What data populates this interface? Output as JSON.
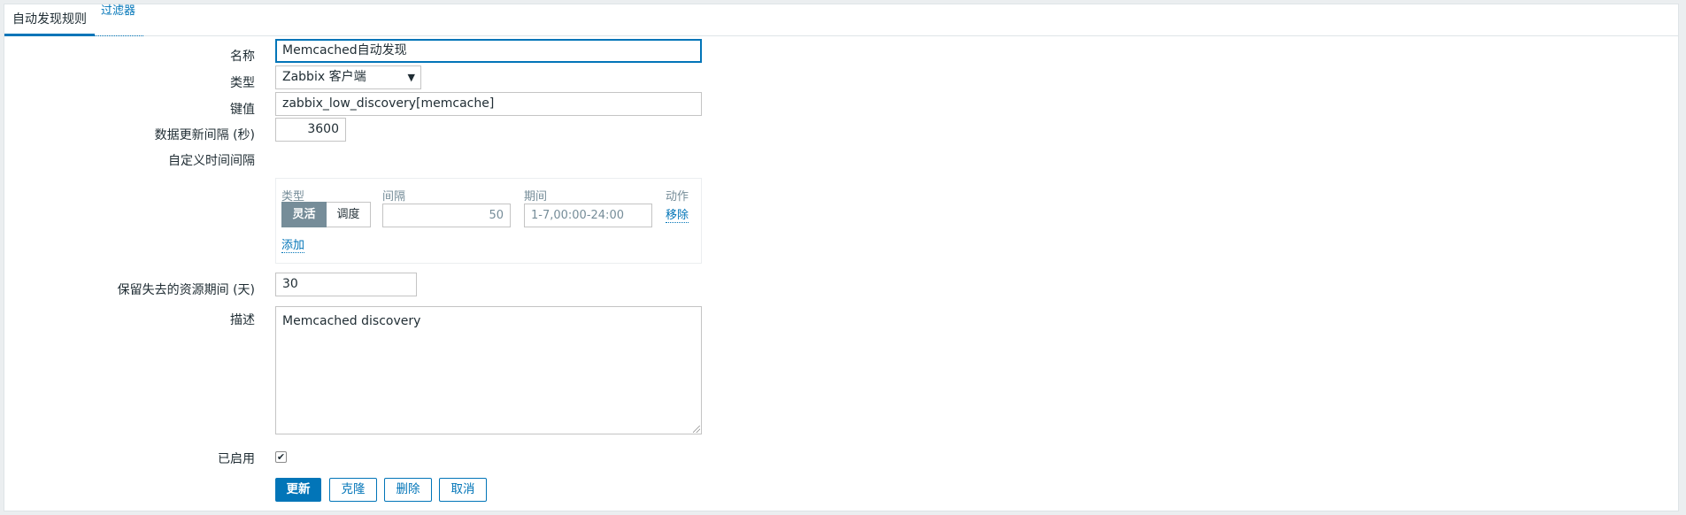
{
  "tabs": [
    {
      "label": "自动发现规则",
      "active": true
    },
    {
      "label": "过滤器",
      "active": false
    }
  ],
  "form": {
    "name": {
      "label": "名称",
      "value": "Memcached自动发现"
    },
    "type": {
      "label": "类型",
      "value": "Zabbix 客户端"
    },
    "key": {
      "label": "键值",
      "value": "zabbix_low_discovery[memcache]"
    },
    "interval": {
      "label": "数据更新间隔 (秒)",
      "value": "3600"
    },
    "custom_intervals": {
      "label": "自定义时间间隔",
      "headers": {
        "type": "类型",
        "interval": "间隔",
        "period": "期间",
        "action": "动作"
      },
      "row": {
        "type_options": [
          "灵活",
          "调度"
        ],
        "selected_type": "灵活",
        "interval_placeholder": "50",
        "period_placeholder": "1-7,00:00-24:00",
        "remove_label": "移除"
      },
      "add_label": "添加"
    },
    "lifetime": {
      "label": "保留失去的资源期间 (天)",
      "value": "30"
    },
    "description": {
      "label": "描述",
      "value": "Memcached discovery"
    },
    "enabled": {
      "label": "已启用",
      "checked": true,
      "check_mark": "✔"
    }
  },
  "buttons": {
    "update": "更新",
    "clone": "克隆",
    "delete": "删除",
    "cancel": "取消"
  },
  "colors": {
    "accent": "#0275b8",
    "muted": "#768d99"
  }
}
